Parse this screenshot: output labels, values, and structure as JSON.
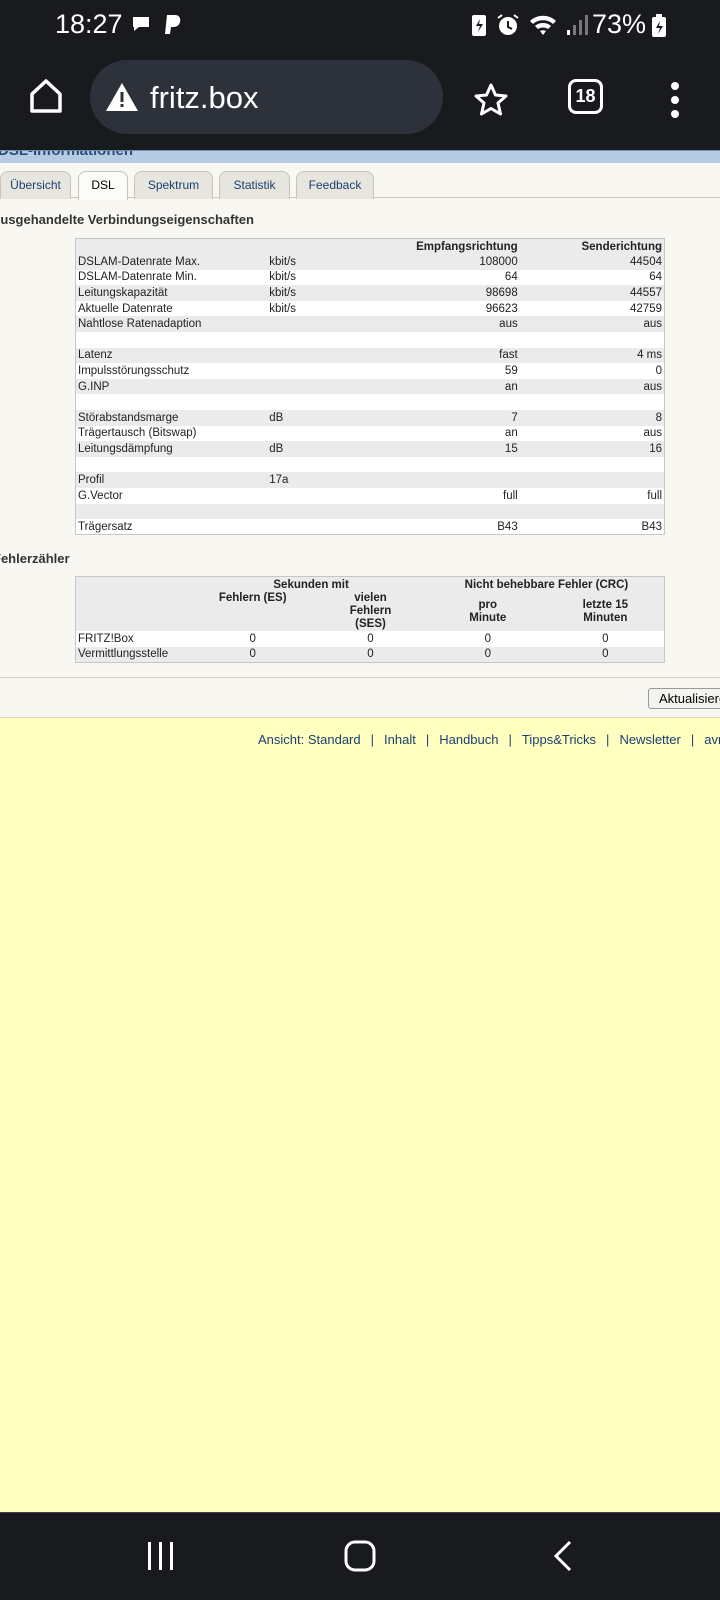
{
  "status": {
    "time": "18:27",
    "battery": "73%"
  },
  "browser": {
    "url": "fritz.box",
    "tab_count": "18"
  },
  "page": {
    "title_fragment": "DSL-Informationen",
    "tabs": [
      "Übersicht",
      "DSL",
      "Spektrum",
      "Statistik",
      "Feedback"
    ],
    "active_tab": "DSL",
    "section1_title": "Ausgehandelte Verbindungseigenschaften",
    "section1_headers": [
      "",
      "",
      "Empfangsrichtung",
      "Senderichtung"
    ],
    "section1_rows": [
      [
        "DSLAM-Datenrate Max.",
        "kbit/s",
        "108000",
        "44504"
      ],
      [
        "DSLAM-Datenrate Min.",
        "kbit/s",
        "64",
        "64"
      ],
      [
        "Leitungskapazität",
        "kbit/s",
        "98698",
        "44557"
      ],
      [
        "Aktuelle Datenrate",
        "kbit/s",
        "96623",
        "42759"
      ],
      [
        "Nahtlose Ratenadaption",
        "",
        "aus",
        "aus"
      ],
      [
        "",
        "",
        "",
        ""
      ],
      [
        "Latenz",
        "",
        "fast",
        "4 ms"
      ],
      [
        "Impulsstörungsschutz",
        "",
        "59",
        "0"
      ],
      [
        "G.INP",
        "",
        "an",
        "aus"
      ],
      [
        "",
        "",
        "",
        ""
      ],
      [
        "Störabstandsmarge",
        "dB",
        "7",
        "8"
      ],
      [
        "Trägertausch (Bitswap)",
        "",
        "an",
        "aus"
      ],
      [
        "Leitungsdämpfung",
        "dB",
        "15",
        "16"
      ],
      [
        "",
        "",
        "",
        ""
      ],
      [
        "Profil",
        "17a",
        "",
        ""
      ],
      [
        "G.Vector",
        "",
        "full",
        "full"
      ],
      [
        "",
        "",
        "",
        ""
      ],
      [
        "Trägersatz",
        "",
        "B43",
        "B43"
      ]
    ],
    "section2_title": "Fehlerzähler",
    "section2_group_headers": [
      "Sekunden mit",
      "Nicht behebbare Fehler (CRC)"
    ],
    "section2_sub_headers": [
      "Fehlern (ES)",
      "vielen Fehlern (SES)",
      "pro Minute",
      "letzte 15 Minuten"
    ],
    "section2_rows": [
      [
        "FRITZ!Box",
        "0",
        "0",
        "0",
        "0"
      ],
      [
        "Vermittlungsstelle",
        "0",
        "0",
        "0",
        "0"
      ]
    ],
    "refresh_button": "Aktualisieren"
  },
  "footer": {
    "links": [
      "Ansicht: Standard",
      "Inhalt",
      "Handbuch",
      "Tipps&Tricks",
      "Newsletter",
      "avm.de"
    ]
  }
}
